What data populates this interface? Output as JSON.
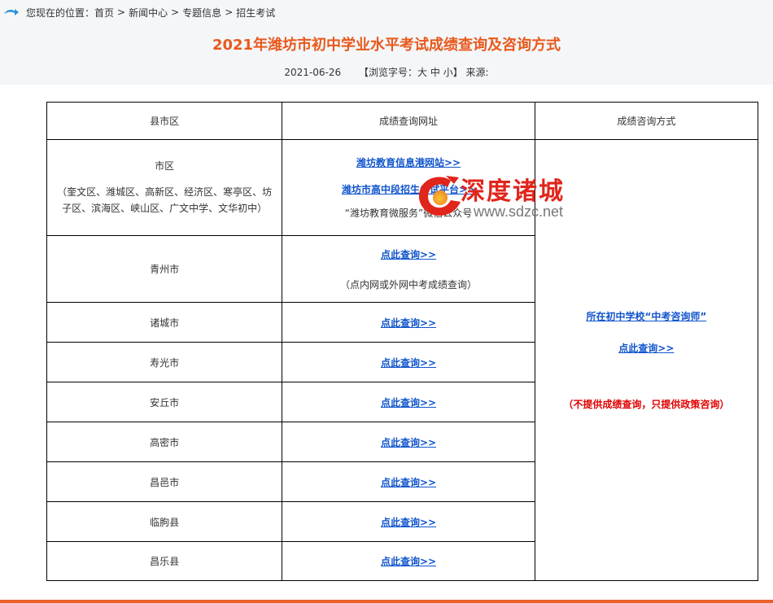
{
  "breadcrumb": {
    "prefix": "您现在的位置：",
    "items": [
      "首页",
      "新闻中心",
      "专题信息",
      "招生考试"
    ],
    "separator": ">"
  },
  "article": {
    "title": "2021年潍坊市初中学业水平考试成绩查询及咨询方式",
    "date": "2021-06-26",
    "font_size_prefix": "【浏览字号：",
    "font_size_options": [
      "大",
      "中",
      "小"
    ],
    "font_size_suffix": "】",
    "source_label": "来源:"
  },
  "table": {
    "headers": [
      "县市区",
      "成绩查询网址",
      "成绩咨询方式"
    ],
    "rows": [
      {
        "district": "市区",
        "district_note_line1": "（奎文区、潍城区、高新区、经济区、寒亭区、坊",
        "district_note_line2": "子区、滨海区、峡山区、广文中学、文华初中）",
        "link1": "潍坊教育信息港网站>>",
        "link2": "潍坊市高中段招生考试平台>>",
        "note": "“潍坊教育微服务”微信公众号"
      },
      {
        "district": "青州市",
        "link": "点此查询>>",
        "note": "（点内网或外网中考成绩查询）"
      },
      {
        "district": "诸城市",
        "link": "点此查询>>"
      },
      {
        "district": "寿光市",
        "link": "点此查询>>"
      },
      {
        "district": "安丘市",
        "link": "点此查询>>"
      },
      {
        "district": "高密市",
        "link": "点此查询>>"
      },
      {
        "district": "昌邑市",
        "link": "点此查询>>"
      },
      {
        "district": "临朐县",
        "link": "点此查询>>"
      },
      {
        "district": "昌乐县",
        "link": "点此查询>>"
      }
    ],
    "consult": {
      "link1": "所在初中学校“中考咨询师”",
      "link2": "点此查询>>",
      "note": "（不提供成绩查询，只提供政策咨询）"
    }
  },
  "watermark": {
    "brand": "深度诸城",
    "url": "www.sdzc.net"
  },
  "colors": {
    "title": "#e8591c",
    "link": "#1155cc",
    "warning": "#e00000",
    "header_bg": "#f4f6f8"
  }
}
